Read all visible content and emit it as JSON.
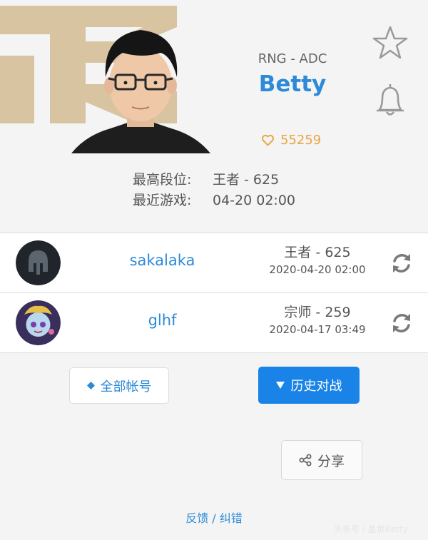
{
  "profile": {
    "team_role": "RNG - ADC",
    "player_name": "Betty",
    "likes": "55259",
    "highest_rank_label": "最高段位:",
    "highest_rank_value": "王者 - 625",
    "recent_game_label": "最近游戏:",
    "recent_game_value": "04-20 02:00"
  },
  "accounts": [
    {
      "name": "sakalaka",
      "rank": "王者 - 625",
      "time": "2020-04-20 02:00",
      "avatar_icon": "spartan-helmet-icon"
    },
    {
      "name": "glhf",
      "rank": "宗师 - 259",
      "time": "2020-04-17 03:49",
      "avatar_icon": "champion-portrait"
    }
  ],
  "buttons": {
    "all_accounts": "全部帐号",
    "history": "历史对战",
    "share": "分享"
  },
  "footer": {
    "feedback": "反馈 / 纠错",
    "watermark": "头条号 / 盖世Betty"
  },
  "colors": {
    "accent_blue": "#2d8ad8",
    "button_blue": "#1a83e8",
    "like_orange": "#e9a640",
    "team_logo_tan": "#d9c4a2"
  }
}
